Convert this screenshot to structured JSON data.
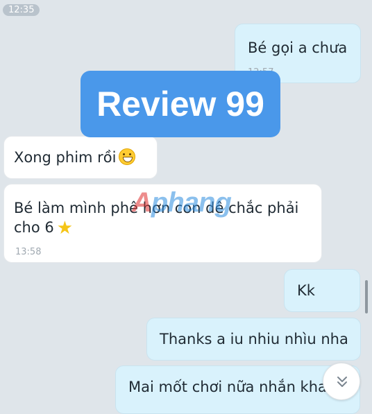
{
  "header": {
    "time_chip": "12:35"
  },
  "messages": [
    {
      "direction": "outgoing",
      "text": "Bé gọi a chưa",
      "time": "12:57"
    },
    {
      "direction": "incoming",
      "text": "Xong phim rồi",
      "emoji": "grinning-face"
    },
    {
      "direction": "incoming",
      "text": "Bé làm mình phê hơn con dê chắc phải cho 6",
      "emoji": "star",
      "time": "13:58"
    },
    {
      "direction": "outgoing",
      "text": "Kk"
    },
    {
      "direction": "outgoing",
      "text": "Thanks a iu nhiu nhìu nha"
    },
    {
      "direction": "outgoing",
      "text": "Mai mốt chơi nữa nhắn kha"
    }
  ],
  "overlay": {
    "banner": "Review 99",
    "logo_first": "A",
    "logo_rest": "phang"
  },
  "colors": {
    "background": "#dfe5ea",
    "outgoing_bubble": "#d9f2fc",
    "incoming_bubble": "#ffffff",
    "banner": "#4a98ea"
  },
  "icons": {
    "scroll_down": "chevron-double-down-icon"
  }
}
